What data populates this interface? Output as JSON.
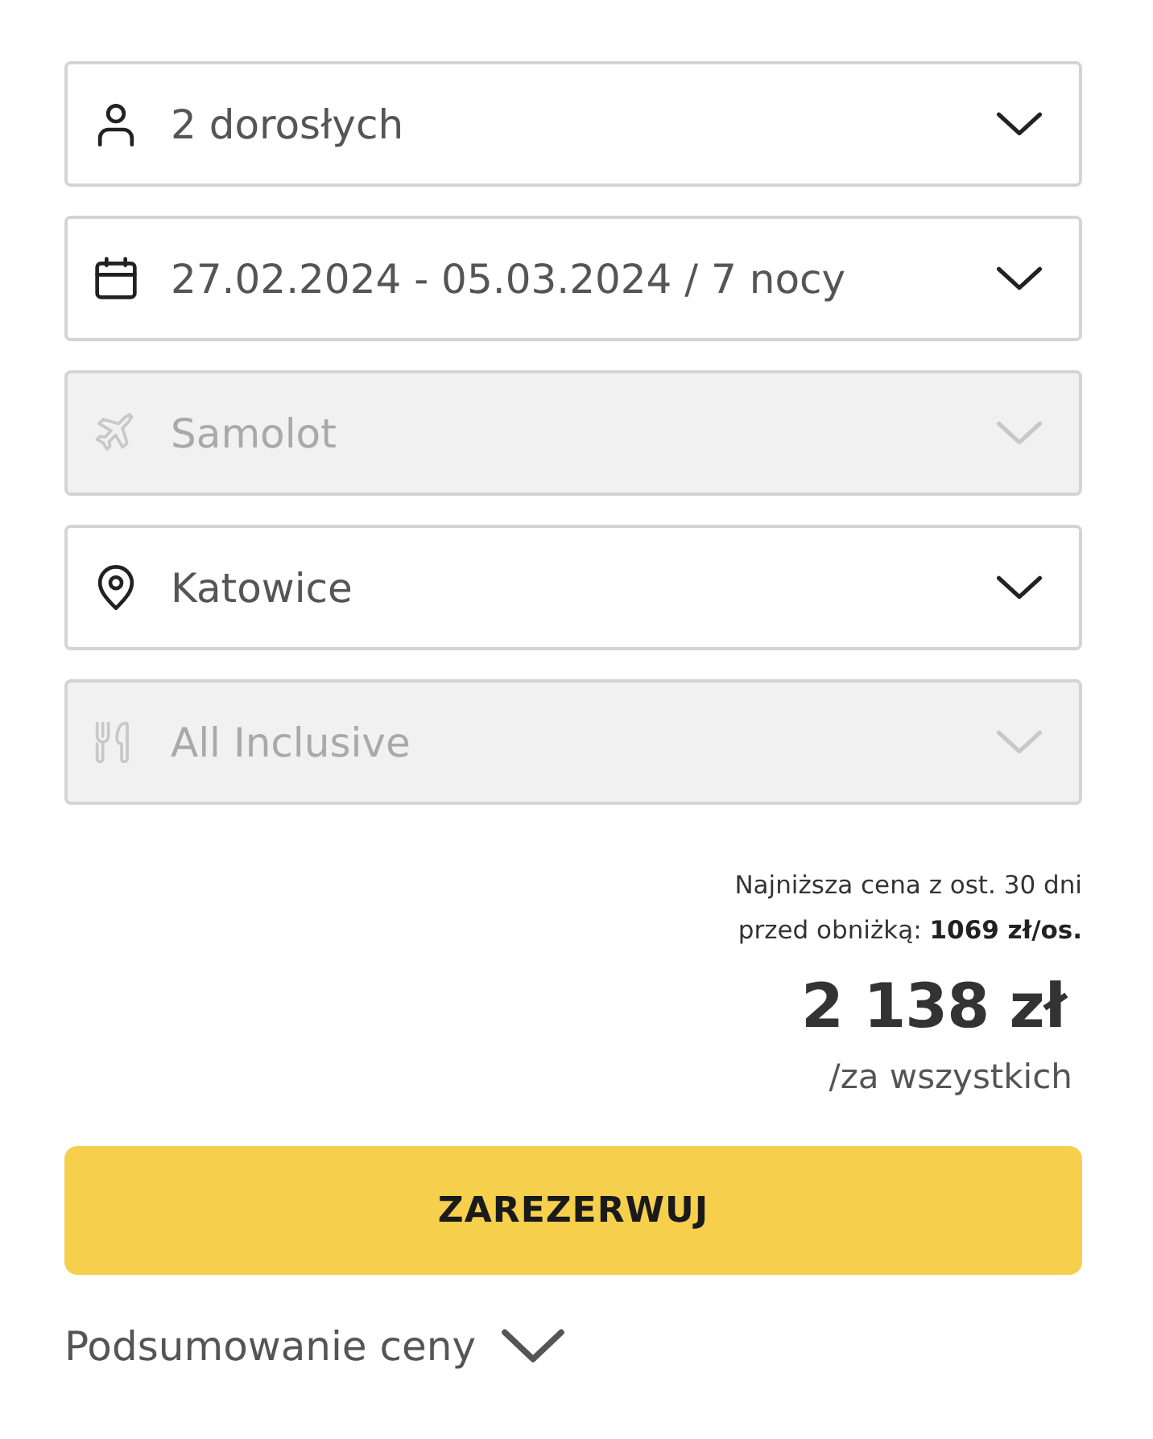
{
  "fields": [
    {
      "kind": "travelers",
      "value": "2 dorosłych",
      "disabled": false
    },
    {
      "kind": "dates",
      "value": "27.02.2024 - 05.03.2024 / 7 nocy",
      "disabled": false
    },
    {
      "kind": "transport",
      "value": "Samolot",
      "disabled": true
    },
    {
      "kind": "departure",
      "value": "Katowice",
      "disabled": false
    },
    {
      "kind": "board",
      "value": "All Inclusive",
      "disabled": true
    }
  ],
  "price": {
    "lowest_note": [
      "Najniższa cena z ost. 30 dni",
      "przed obniżką: **1069 zł/os.**"
    ],
    "total": "2 138 zł",
    "total_note": "/za wszystkich"
  },
  "book_button": "ZAREZERWUJ",
  "summary": {
    "label": "Podsumowanie ceny",
    "expanded": false
  }
}
